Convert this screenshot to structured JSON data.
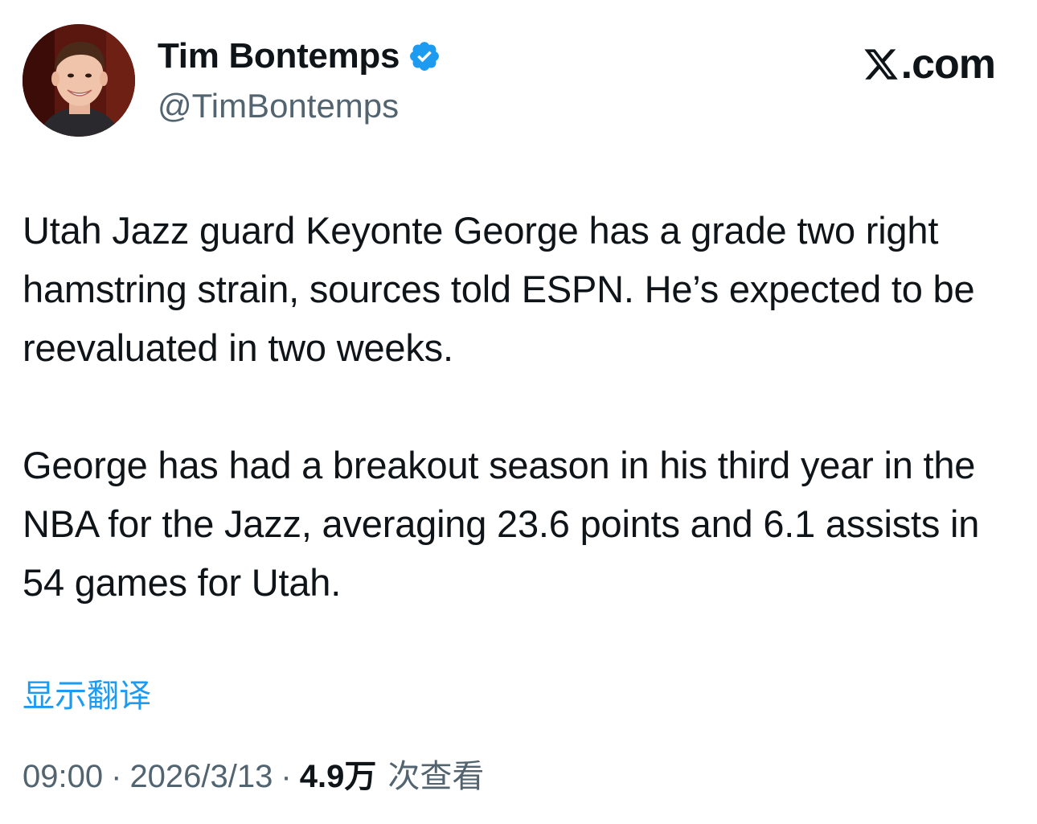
{
  "author": {
    "display_name": "Tim Bontemps",
    "handle": "@TimBontemps",
    "verified": true,
    "avatar_icon": "avatar-photo"
  },
  "brand": {
    "text": ".com",
    "logo_icon": "x-logo-icon"
  },
  "tweet": {
    "paragraphs": [
      "Utah Jazz guard Keyonte George has a grade two right hamstring strain, sources told ESPN. He’s expected to be reevaluated in two weeks.",
      "George has had a breakout season in his third year in the NBA for the Jazz, averaging 23.6 points and 6.1 assists in 54 games for Utah."
    ]
  },
  "translate_label": "显示翻译",
  "meta": {
    "time": "09:00",
    "separator": "·",
    "date": "2026/3/13",
    "views_count": "4.9万",
    "views_label": "次查看"
  },
  "colors": {
    "text": "#0f1419",
    "secondary": "#536471",
    "accent": "#1d9bf0"
  }
}
